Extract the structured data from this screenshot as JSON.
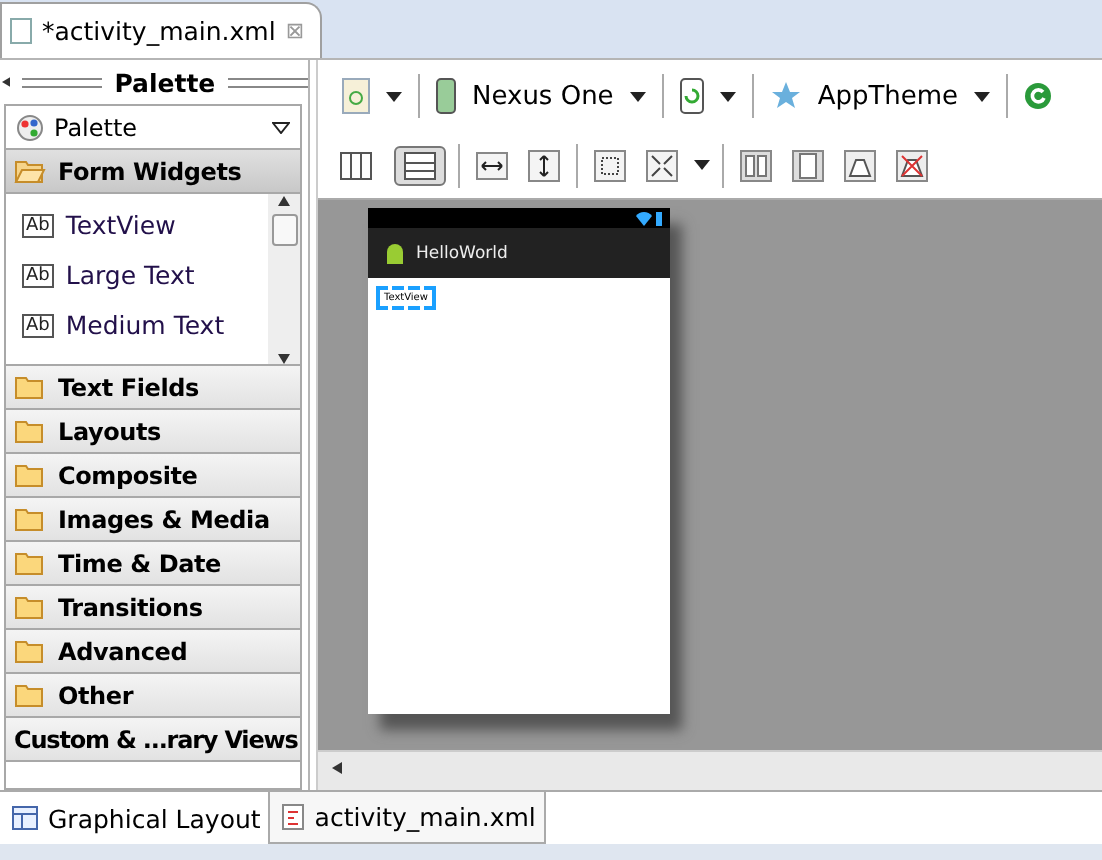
{
  "editor_tab": {
    "title": "*activity_main.xml",
    "close": "⊠"
  },
  "palette": {
    "header": "Palette",
    "dropdown": "Palette",
    "categories": [
      {
        "label": "Form Widgets",
        "expanded": true,
        "folder": true,
        "items": [
          {
            "label": "TextView",
            "icon": "Ab"
          },
          {
            "label": "Large Text",
            "icon": "Ab"
          },
          {
            "label": "Medium Text",
            "icon": "Ab"
          }
        ]
      },
      {
        "label": "Text Fields",
        "expanded": false,
        "folder": true
      },
      {
        "label": "Layouts",
        "expanded": false,
        "folder": true
      },
      {
        "label": "Composite",
        "expanded": false,
        "folder": true
      },
      {
        "label": "Images & Media",
        "expanded": false,
        "folder": true
      },
      {
        "label": "Time & Date",
        "expanded": false,
        "folder": true
      },
      {
        "label": "Transitions",
        "expanded": false,
        "folder": true
      },
      {
        "label": "Advanced",
        "expanded": false,
        "folder": true
      },
      {
        "label": "Other",
        "expanded": false,
        "folder": true
      },
      {
        "label": "Custom & ...rary Views",
        "expanded": false,
        "folder": false
      }
    ]
  },
  "toolbar": {
    "device": "Nexus One",
    "theme": "AppTheme"
  },
  "view_modes": [
    {
      "kind": "columns",
      "selected": false
    },
    {
      "kind": "rows",
      "selected": true
    }
  ],
  "phone": {
    "app_title": "HelloWorld",
    "widget": "TextView"
  },
  "bottom_tabs": [
    {
      "label": "Graphical Layout",
      "kind": "layout",
      "selected": true
    },
    {
      "label": "activity_main.xml",
      "kind": "xml",
      "selected": false
    }
  ]
}
